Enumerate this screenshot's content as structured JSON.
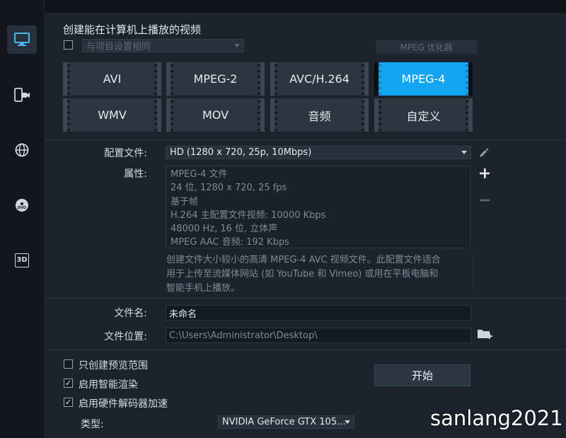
{
  "sidebar": {
    "items": [
      {
        "icon": "monitor-icon",
        "active": true
      },
      {
        "icon": "mobile-device-icon",
        "active": false
      },
      {
        "icon": "globe-icon",
        "active": false
      },
      {
        "icon": "dvd-icon",
        "active": false,
        "text": "DVD"
      },
      {
        "icon": "3d-icon",
        "active": false,
        "text": "3D"
      }
    ]
  },
  "header": {
    "title": "创建能在计算机上播放的视频",
    "same_as_project_label": "与项目设置相同",
    "optimizer_label": "MPEG 优化器"
  },
  "formats": [
    {
      "label": "AVI",
      "active": false
    },
    {
      "label": "MPEG-2",
      "active": false
    },
    {
      "label": "AVC/H.264",
      "active": false
    },
    {
      "label": "MPEG-4",
      "active": true
    },
    {
      "label": "WMV",
      "active": false
    },
    {
      "label": "MOV",
      "active": false
    },
    {
      "label": "音频",
      "active": false
    },
    {
      "label": "自定义",
      "active": false
    }
  ],
  "profile": {
    "label": "配置文件:",
    "value": "HD (1280 x 720, 25p, 10Mbps)"
  },
  "properties": {
    "label": "属性:",
    "lines": [
      "MPEG-4 文件",
      "24 位, 1280 x 720, 25 fps",
      "基于帧",
      "H.264 主配置文件视频: 10000 Kbps",
      "48000 Hz, 16 位, 立体声",
      "MPEG AAC 音频: 192 Kbps"
    ]
  },
  "description": {
    "lines": [
      "创建文件大小较小的高清 MPEG-4 AVC 视频文件。此配置文件适合",
      "用于上传至流媒体网站 (如 YouTube 和 Vimeo) 或用在平板电脑和",
      "智能手机上播放。"
    ]
  },
  "file": {
    "name_label": "文件名:",
    "name_value": "未命名",
    "location_label": "文件位置:",
    "location_value": "C:\\Users\\Administrator\\Desktop\\"
  },
  "options": {
    "preview_range": {
      "label": "只创建预览范围",
      "checked": false
    },
    "smart_render": {
      "label": "启用智能渲染",
      "checked": true
    },
    "hw_decoder": {
      "label": "启用硬件解码器加速",
      "checked": true
    },
    "type_label": "类型:",
    "type_value": "NVIDIA GeForce GTX 105..."
  },
  "start_label": "开始",
  "watermark": "sanlang2021",
  "colors": {
    "accent": "#14a5f2",
    "panel": "#1c232d",
    "background": "#0f141b"
  }
}
